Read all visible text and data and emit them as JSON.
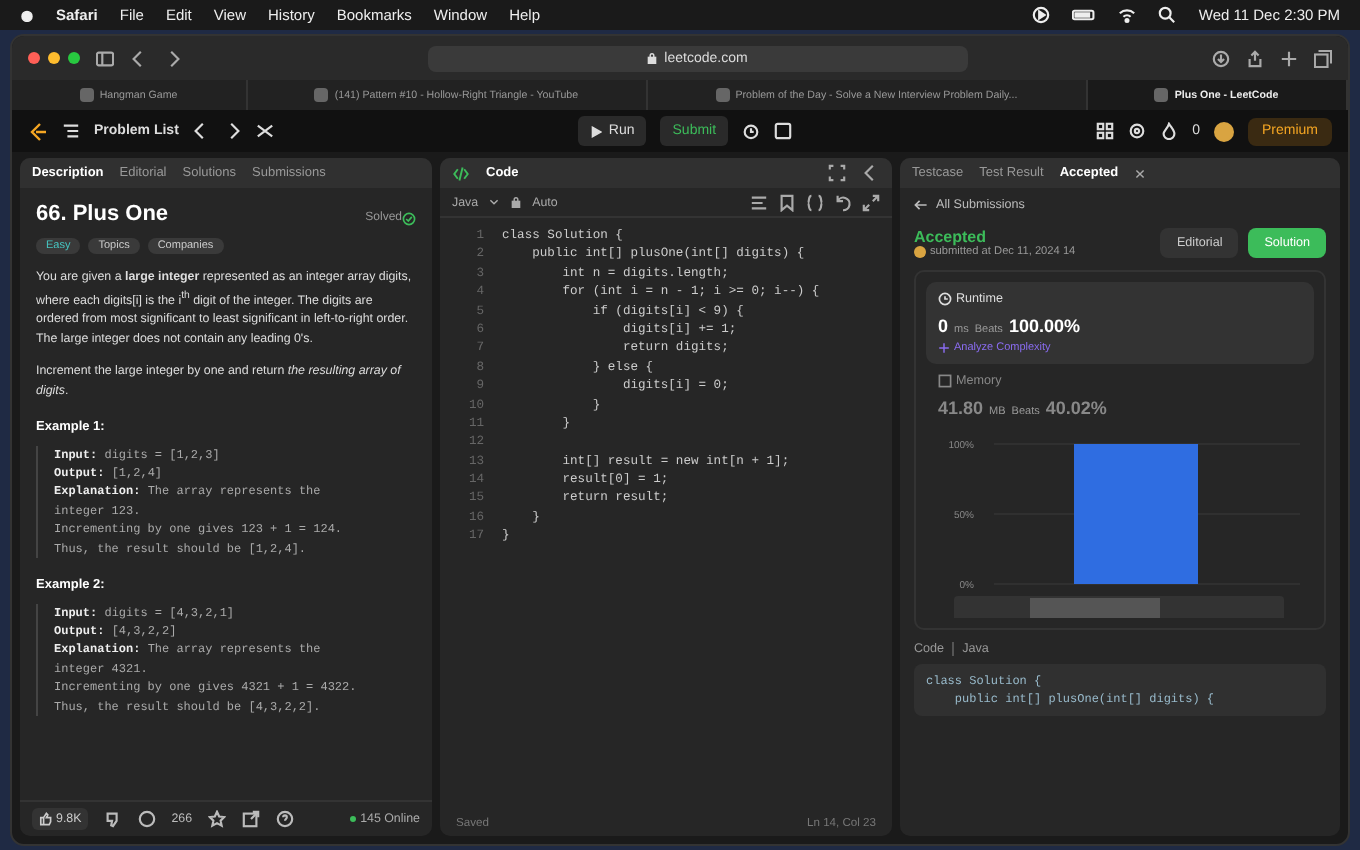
{
  "menubar": {
    "app": "Safari",
    "menus": [
      "File",
      "Edit",
      "View",
      "History",
      "Bookmarks",
      "Window",
      "Help"
    ],
    "clock": "Wed 11 Dec  2:30 PM"
  },
  "browser": {
    "address": "leetcode.com",
    "tabs": [
      {
        "title": "Hangman Game",
        "selected": false
      },
      {
        "title": "(141) Pattern #10 - Hollow-Right Triangle - YouTube",
        "selected": false
      },
      {
        "title": "Problem of the Day - Solve a New Interview Problem Daily...",
        "selected": false
      },
      {
        "title": "Plus One - LeetCode",
        "selected": true
      }
    ]
  },
  "nav": {
    "problem_list": "Problem List",
    "run": "Run",
    "submit": "Submit",
    "streak": "0",
    "premium": "Premium"
  },
  "description": {
    "tabs": [
      {
        "label": "Description",
        "selected": true
      },
      {
        "label": "Editorial",
        "selected": false
      },
      {
        "label": "Solutions",
        "selected": false
      },
      {
        "label": "Submissions",
        "selected": false
      }
    ],
    "title": "66. Plus One",
    "status": "Solved",
    "tags": [
      "Easy",
      "Topics",
      "Companies"
    ],
    "paragraphs": [
      "You are given a **large integer** represented as an integer array digits, where each digits[i] is the i$^{th}$ digit of the integer. The digits are ordered from most significant to least significant in left-to-right order. The large integer does not contain any leading 0's.",
      "Increment the large integer by one and return *the resulting array of digits*."
    ],
    "examples": [
      {
        "title": "Example 1:",
        "lines": [
          {
            "label": "Input:",
            "text": "digits = [1,2,3]"
          },
          {
            "label": "Output:",
            "text": "[1,2,4]"
          },
          {
            "label": "Explanation:",
            "text": "The array represents the"
          },
          {
            "text": "integer 123."
          },
          {
            "text": "Incrementing by one gives 123 + 1 = 124."
          },
          {
            "text": "Thus, the result should be [1,2,4]."
          }
        ]
      },
      {
        "title": "Example 2:",
        "lines": [
          {
            "label": "Input:",
            "text": "digits = [4,3,2,1]"
          },
          {
            "label": "Output:",
            "text": "[4,3,2,2]"
          },
          {
            "label": "Explanation:",
            "text": "The array represents the"
          },
          {
            "text": "integer 4321."
          },
          {
            "text": "Incrementing by one gives 4321 + 1 = 4322."
          },
          {
            "text": "Thus, the result should be [4,3,2,2]."
          }
        ]
      }
    ],
    "footer": {
      "likes": "9.8K",
      "comments": "266",
      "online": "145 Online"
    }
  },
  "code": {
    "title": "Code",
    "language": "Java",
    "mode": "Auto",
    "lines": [
      {
        "number": "1",
        "text": "class Solution {"
      },
      {
        "number": "2",
        "text": "    public int[] plusOne(int[] digits) {"
      },
      {
        "number": "3",
        "text": "        int n = digits.length;"
      },
      {
        "number": "4",
        "text": "        for (int i = n - 1; i >= 0; i--) {"
      },
      {
        "number": "5",
        "text": "            if (digits[i] < 9) {"
      },
      {
        "number": "6",
        "text": "                digits[i] += 1;"
      },
      {
        "number": "7",
        "text": "                return digits;"
      },
      {
        "number": "8",
        "text": "            } else {"
      },
      {
        "number": "9",
        "text": "                digits[i] = 0;"
      },
      {
        "number": "10",
        "text": "            }"
      },
      {
        "number": "11",
        "text": "        }"
      },
      {
        "number": "12"
      },
      {
        "number": "13",
        "text": "        int[] result = new int[n + 1];"
      },
      {
        "number": "14",
        "text": "        result[0] = 1;"
      },
      {
        "number": "15",
        "text": "        return result;"
      },
      {
        "number": "16",
        "text": "    }"
      },
      {
        "number": "17",
        "text": "}"
      }
    ],
    "status": "Saved",
    "cursor": "Ln 14, Col 23"
  },
  "result": {
    "tabs": [
      {
        "label": "Testcase",
        "selected": false
      },
      {
        "label": "Test Result",
        "selected": false
      },
      {
        "label": "Accepted",
        "selected": true
      }
    ],
    "back": "All Submissions",
    "verdict": "Accepted",
    "submitted": "submitted at Dec 11, 2024 14",
    "editorial": "Editorial",
    "solution": "Solution",
    "runtime": {
      "label": "Runtime",
      "value": "0",
      "unit": "ms",
      "beats_label": "Beats",
      "beats": "100.00%",
      "analyze": "Analyze Complexity"
    },
    "memory": {
      "label": "Memory",
      "value": "41.80",
      "unit": "MB",
      "beats_label": "Beats",
      "beats": "40.02%"
    },
    "chart_data": {
      "type": "bar",
      "values": [
        100
      ],
      "ylim": [
        0,
        100
      ],
      "yticks": [
        {
          "value": 0,
          "label": "0%"
        },
        {
          "value": 50,
          "label": "50%"
        },
        {
          "value": 100,
          "label": "100%"
        }
      ]
    },
    "code_label": "Code",
    "code_language": "Java",
    "code_preview": [
      "class Solution {",
      "    public int[] plusOne(int[] digits) {"
    ]
  }
}
